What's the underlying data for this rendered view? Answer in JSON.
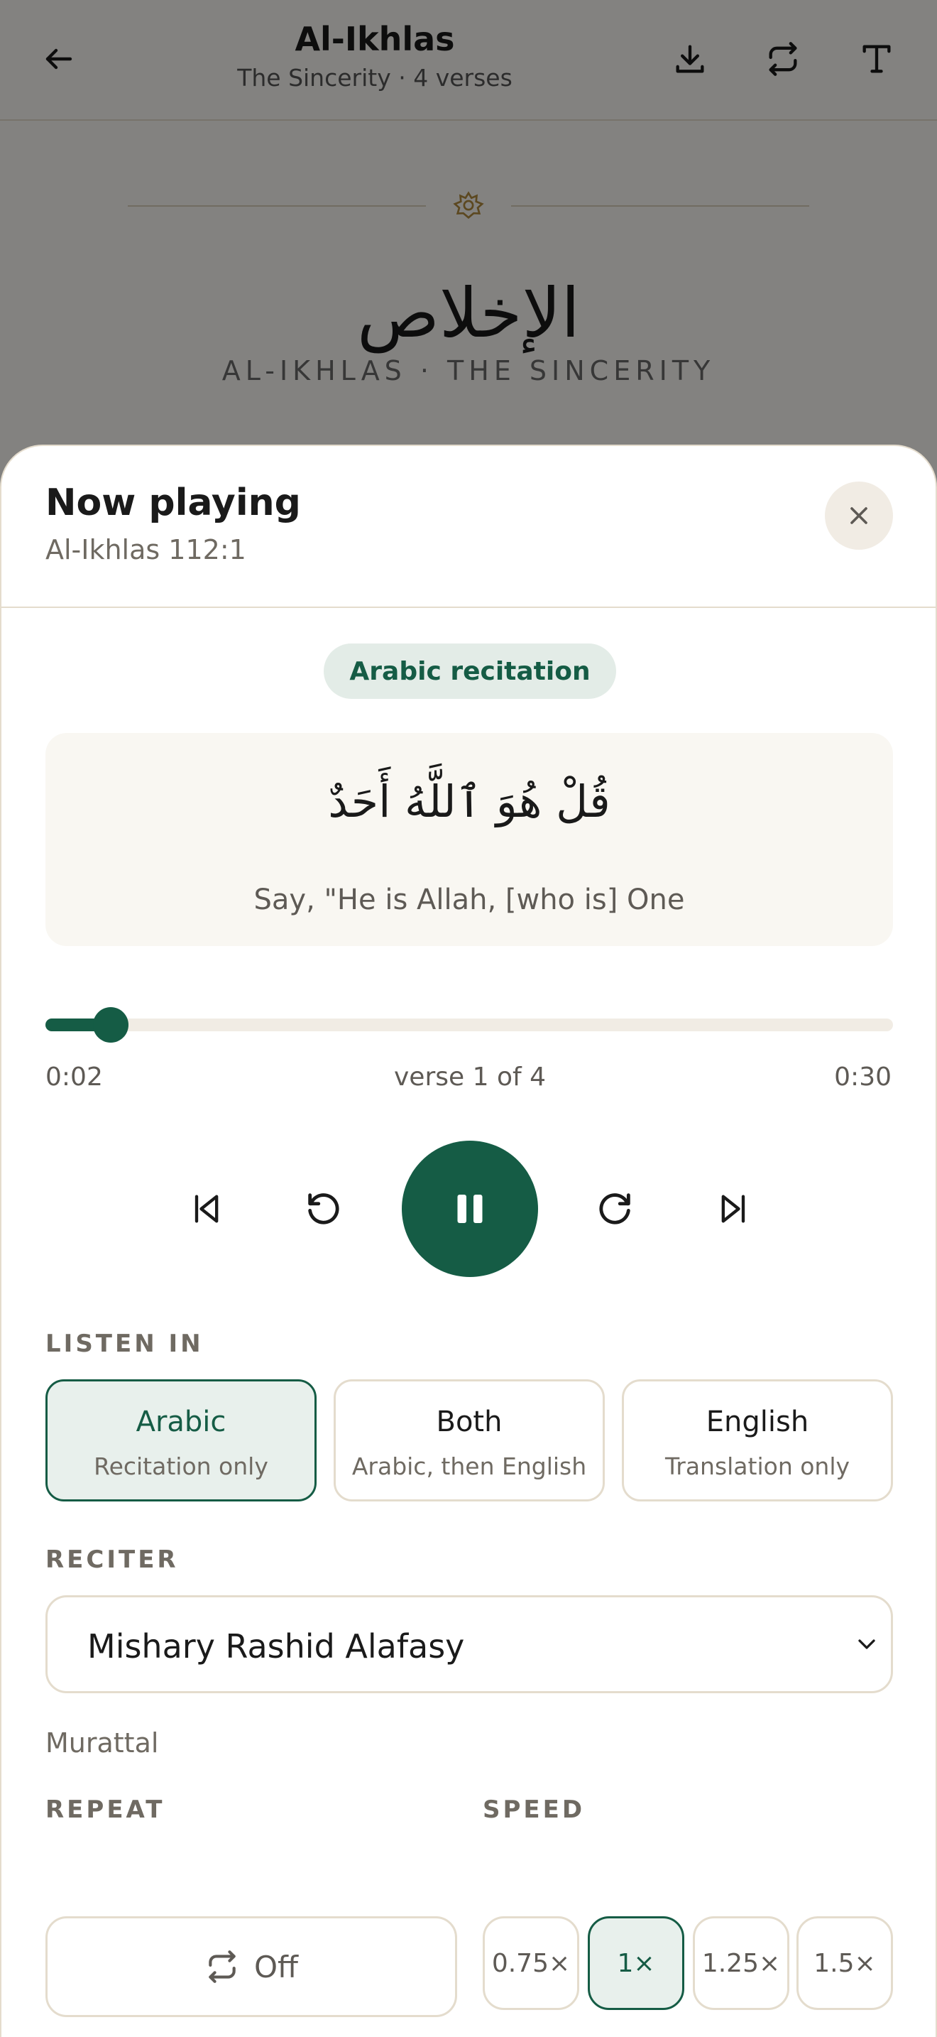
{
  "appbar": {
    "title": "Al-Ikhlas",
    "subtitle": "The Sincerity · 4 verses"
  },
  "surah_header": {
    "arabic": "الإخلاص",
    "english": "AL-IKHLAS · THE SINCERITY"
  },
  "sheet": {
    "title": "Now playing",
    "reference": "Al-Ikhlas 112:1",
    "chip": "Arabic recitation",
    "verse_arabic": "قُلْ هُوَ ٱللَّهُ أَحَدٌ",
    "verse_english": "Say, \"He is Allah, [who is] One",
    "progress_fraction": 0.077,
    "time_elapsed": "0:02",
    "verse_position": "verse 1 of 4",
    "time_total": "0:30"
  },
  "listen_in": {
    "label": "LISTEN IN",
    "options": [
      {
        "title": "Arabic",
        "desc": "Recitation only",
        "selected": true
      },
      {
        "title": "Both",
        "desc": "Arabic, then English",
        "selected": false
      },
      {
        "title": "English",
        "desc": "Translation only",
        "selected": false
      }
    ]
  },
  "reciter": {
    "label": "RECITER",
    "value": "Mishary Rashid Alafasy",
    "style": "Murattal"
  },
  "repeat": {
    "label": "REPEAT",
    "value": "Off"
  },
  "speed": {
    "label": "SPEED",
    "options": [
      "0.75×",
      "1×",
      "1.25×",
      "1.5×"
    ],
    "selected": "1×"
  },
  "colors": {
    "accent": "#155c45",
    "accent_soft": "#e8f0ec",
    "border": "#e4dccd"
  },
  "icons": [
    "back-arrow-icon",
    "download-icon",
    "repeat-icon",
    "text-size-icon",
    "ornament-star-icon",
    "close-icon",
    "skip-previous-icon",
    "rewind-icon",
    "pause-icon",
    "forward-icon",
    "skip-next-icon",
    "chevron-down-icon"
  ]
}
